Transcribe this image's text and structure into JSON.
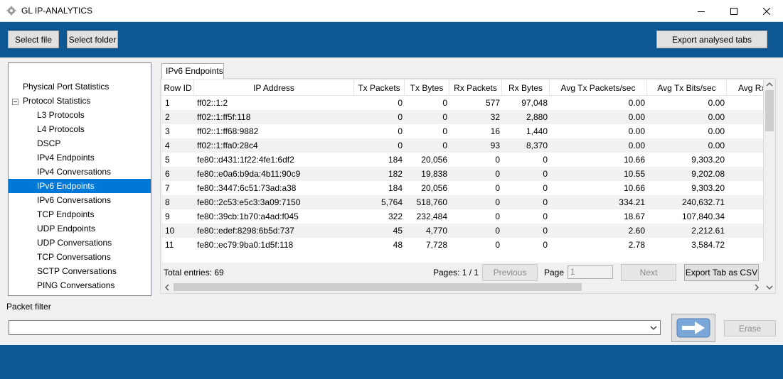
{
  "window": {
    "title": "GL IP-ANALYTICS"
  },
  "toolbar": {
    "select_file": "Select file",
    "select_folder": "Select folder",
    "export_tabs": "Export analysed tabs"
  },
  "tree": {
    "items": [
      {
        "label": "Physical Port Statistics",
        "level": 0
      },
      {
        "label": "Protocol Statistics",
        "level": 0
      },
      {
        "label": "L3 Protocols",
        "level": 1
      },
      {
        "label": "L4 Protocols",
        "level": 1
      },
      {
        "label": "DSCP",
        "level": 1
      },
      {
        "label": "IPv4 Endpoints",
        "level": 1
      },
      {
        "label": "IPv4 Conversations",
        "level": 1
      },
      {
        "label": "IPv6 Endpoints",
        "level": 1,
        "selected": true
      },
      {
        "label": "IPv6 Conversations",
        "level": 1
      },
      {
        "label": "TCP Endpoints",
        "level": 1
      },
      {
        "label": "UDP Endpoints",
        "level": 1
      },
      {
        "label": "UDP Conversations",
        "level": 1
      },
      {
        "label": "TCP Conversations",
        "level": 1
      },
      {
        "label": "SCTP Conversations",
        "level": 1
      },
      {
        "label": "PING Conversations",
        "level": 1
      }
    ]
  },
  "tab": {
    "label": "IPv6 Endpoints"
  },
  "table": {
    "columns": [
      "Row ID",
      "IP Address",
      "Tx Packets",
      "Tx Bytes",
      "Rx Packets",
      "Rx Bytes",
      "Avg Tx Packets/sec",
      "Avg Tx Bits/sec",
      "Avg Rx"
    ],
    "rows": [
      [
        "1",
        "ff02::1:2",
        "0",
        "0",
        "577",
        "97,048",
        "0.00",
        "0.00"
      ],
      [
        "2",
        "ff02::1:ff5f:118",
        "0",
        "0",
        "32",
        "2,880",
        "0.00",
        "0.00"
      ],
      [
        "3",
        "ff02::1:ff68:9882",
        "0",
        "0",
        "16",
        "1,440",
        "0.00",
        "0.00"
      ],
      [
        "4",
        "ff02::1:ffa0:28c4",
        "0",
        "0",
        "93",
        "8,370",
        "0.00",
        "0.00"
      ],
      [
        "5",
        "fe80::d431:1f22:4fe1:6df2",
        "184",
        "20,056",
        "0",
        "0",
        "10.66",
        "9,303.20"
      ],
      [
        "6",
        "fe80::e0a6:b9da:4b11:90c9",
        "182",
        "19,838",
        "0",
        "0",
        "10.55",
        "9,202.08"
      ],
      [
        "7",
        "fe80::3447:6c51:73ad:a38",
        "184",
        "20,056",
        "0",
        "0",
        "10.66",
        "9,303.20"
      ],
      [
        "8",
        "fe80::2c53:e5c3:3a09:7150",
        "5,764",
        "518,760",
        "0",
        "0",
        "334.21",
        "240,632.71"
      ],
      [
        "9",
        "fe80::39cb:1b70:a4ad:f045",
        "322",
        "232,484",
        "0",
        "0",
        "18.67",
        "107,840.34"
      ],
      [
        "10",
        "fe80::edef:8298:6b5d:737",
        "45",
        "4,770",
        "0",
        "0",
        "2.60",
        "2,212.61"
      ],
      [
        "11",
        "fe80::ec79:9ba0:1d5f:118",
        "48",
        "7,728",
        "0",
        "0",
        "2.78",
        "3,584.72"
      ]
    ]
  },
  "footer": {
    "total_entries": "Total entries: 69",
    "pages": "Pages: 1 / 1",
    "previous": "Previous",
    "page_label": "Page",
    "page_value": "1",
    "next": "Next",
    "export_csv": "Export Tab as CSV"
  },
  "filter": {
    "label": "Packet filter",
    "value": "",
    "erase": "Erase"
  },
  "colors": {
    "band": "#0d5893",
    "selection": "#0078d7"
  }
}
